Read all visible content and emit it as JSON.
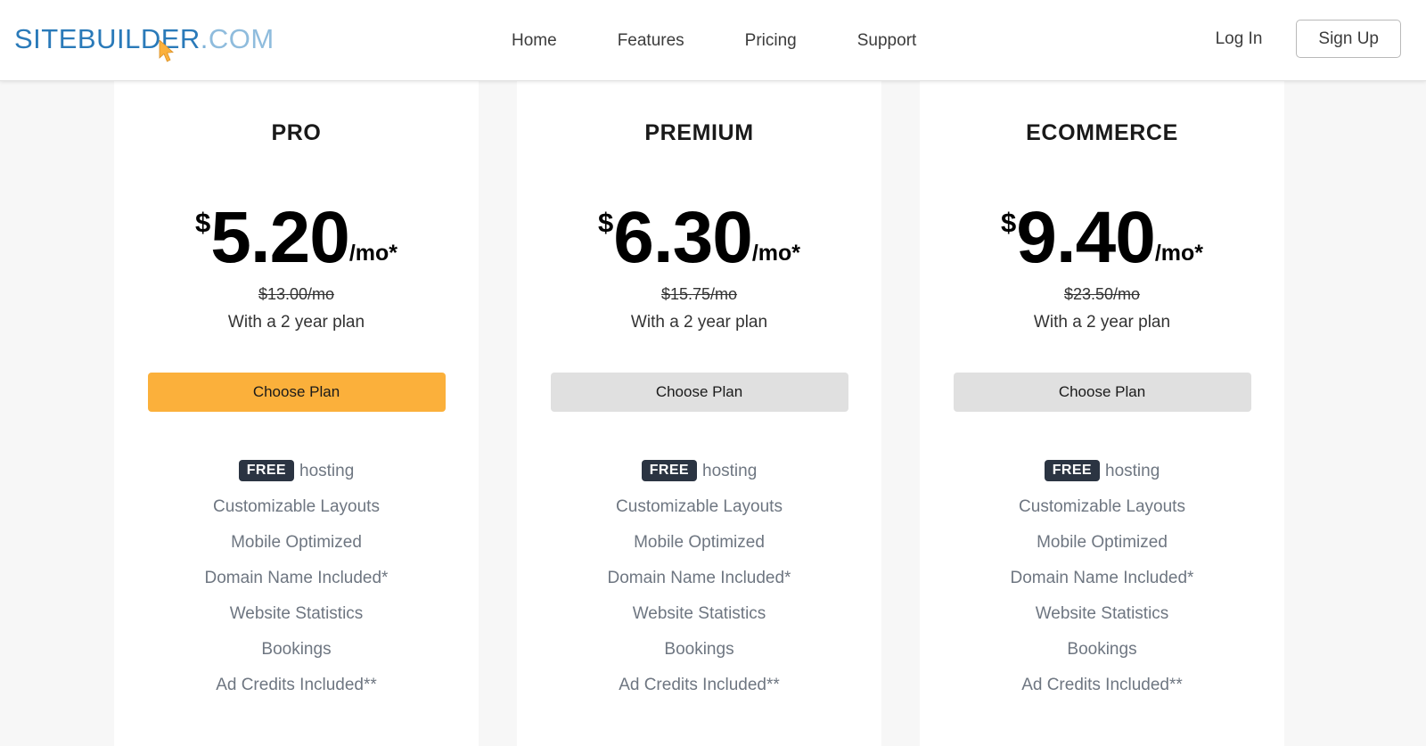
{
  "header": {
    "logo": {
      "main": "SITEBUILDER",
      "dot": ".",
      "com": "COM"
    },
    "nav": [
      {
        "label": "Home"
      },
      {
        "label": "Features"
      },
      {
        "label": "Pricing"
      },
      {
        "label": "Support"
      }
    ],
    "login_label": "Log In",
    "signup_label": "Sign Up",
    "cursor_icon": "arrow-pointer-icon",
    "colors": {
      "logo_main": "#2a7ab9",
      "logo_com": "#8fbcdd",
      "cursor": "#fbb03b"
    }
  },
  "plans": [
    {
      "name": "PRO",
      "currency": "$",
      "amount": "5.20",
      "period": "/mo*",
      "old_price": "$13.00/mo",
      "term": "With a 2 year plan",
      "cta_label": "Choose Plan",
      "cta_style": "primary",
      "cta_color": "#fbb03b",
      "features": [
        {
          "badge": "FREE",
          "label": "hosting"
        },
        {
          "label": "Customizable Layouts"
        },
        {
          "label": "Mobile Optimized"
        },
        {
          "label": "Domain Name Included*"
        },
        {
          "label": "Website Statistics"
        },
        {
          "label": "Bookings"
        },
        {
          "label": "Ad Credits Included**"
        }
      ]
    },
    {
      "name": "PREMIUM",
      "currency": "$",
      "amount": "6.30",
      "period": "/mo*",
      "old_price": "$15.75/mo",
      "term": "With a 2 year plan",
      "cta_label": "Choose Plan",
      "cta_style": "muted",
      "cta_color": "#e0e0e0",
      "features": [
        {
          "badge": "FREE",
          "label": "hosting"
        },
        {
          "label": "Customizable Layouts"
        },
        {
          "label": "Mobile Optimized"
        },
        {
          "label": "Domain Name Included*"
        },
        {
          "label": "Website Statistics"
        },
        {
          "label": "Bookings"
        },
        {
          "label": "Ad Credits Included**"
        }
      ]
    },
    {
      "name": "ECOMMERCE",
      "currency": "$",
      "amount": "9.40",
      "period": "/mo*",
      "old_price": "$23.50/mo",
      "term": "With a 2 year plan",
      "cta_label": "Choose Plan",
      "cta_style": "muted",
      "cta_color": "#e0e0e0",
      "features": [
        {
          "badge": "FREE",
          "label": "hosting"
        },
        {
          "label": "Customizable Layouts"
        },
        {
          "label": "Mobile Optimized"
        },
        {
          "label": "Domain Name Included*"
        },
        {
          "label": "Website Statistics"
        },
        {
          "label": "Bookings"
        },
        {
          "label": "Ad Credits Included**"
        }
      ]
    }
  ]
}
